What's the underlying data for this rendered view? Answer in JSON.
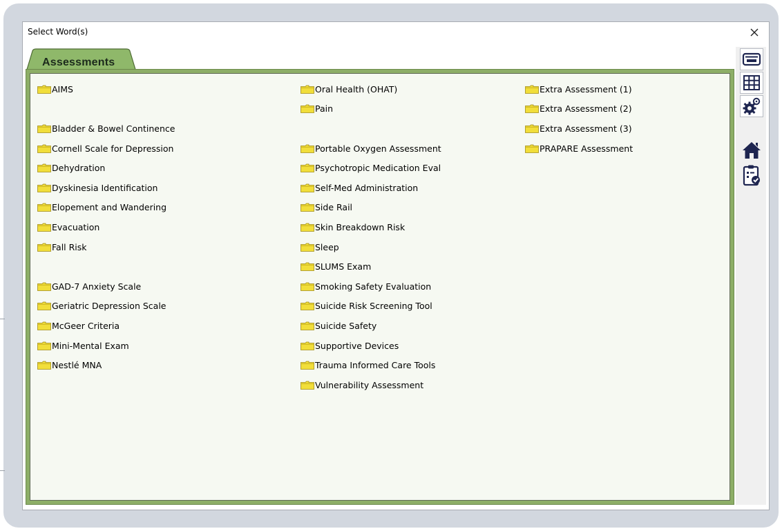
{
  "dialog": {
    "title": "Select Word(s)",
    "close_symbol": "✕"
  },
  "tabs": [
    {
      "label": "Assessments",
      "active": true
    }
  ],
  "columns": [
    [
      "AIMS",
      "",
      "Bladder & Bowel Continence",
      "Cornell Scale for Depression",
      "Dehydration",
      "Dyskinesia Identification",
      "Elopement and Wandering",
      "Evacuation",
      "Fall Risk",
      "",
      "GAD-7 Anxiety Scale",
      "Geriatric Depression Scale",
      "McGeer Criteria",
      "Mini-Mental Exam",
      "Nestlé MNA"
    ],
    [
      "Oral Health (OHAT)",
      "Pain",
      "",
      "Portable Oxygen Assessment",
      "Psychotropic Medication Eval",
      "Self-Med Administration",
      "Side Rail",
      "Skin Breakdown Risk",
      "Sleep",
      "SLUMS Exam",
      "Smoking Safety Evaluation",
      "Suicide Risk Screening Tool",
      "Suicide Safety",
      "Supportive Devices",
      "Trauma Informed Care Tools",
      "Vulnerability Assessment"
    ],
    [
      "Extra Assessment (1)",
      "Extra Assessment (2)",
      "Extra Assessment (3)",
      "PRAPARE Assessment"
    ]
  ],
  "sidebar": {
    "buttons": [
      "keyboard-icon",
      "grid-icon",
      "settings-gears-icon",
      "home-icon",
      "clipboard-check-icon"
    ]
  },
  "colors": {
    "panel_green": "#8dae67",
    "tab_green": "#8fb86a",
    "folder_yellow": "#f1de3a",
    "icon_navy": "#1e2550"
  }
}
